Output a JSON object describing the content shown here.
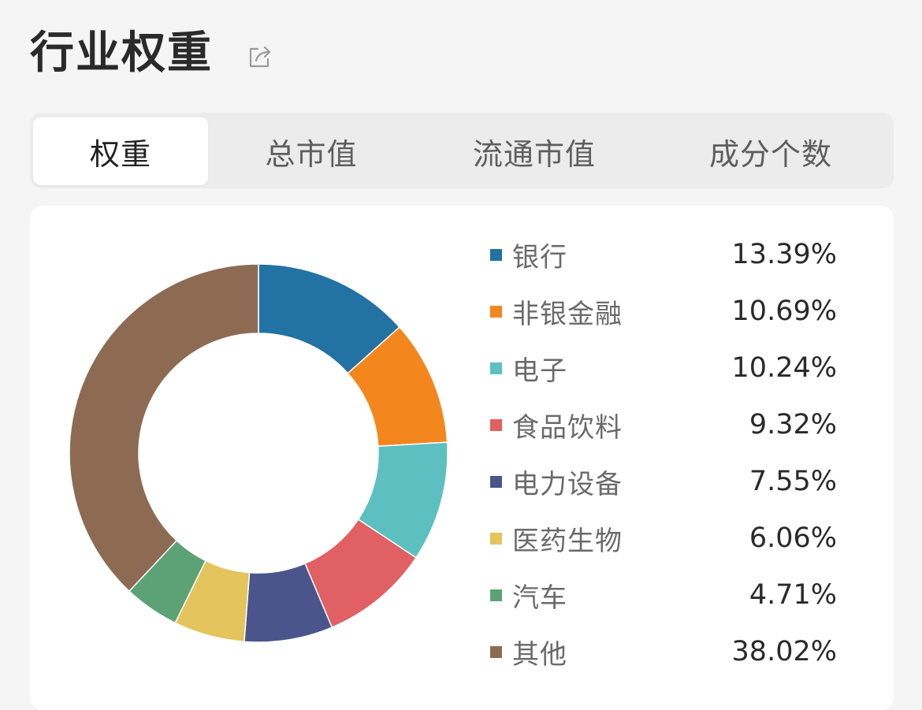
{
  "header": {
    "title": "行业权重",
    "share_icon": "share-icon"
  },
  "tabs": [
    {
      "label": "权重",
      "active": true
    },
    {
      "label": "总市值",
      "active": false
    },
    {
      "label": "流通市值",
      "active": false
    },
    {
      "label": "成分个数",
      "active": false
    }
  ],
  "chart_data": {
    "type": "pie",
    "title": "",
    "categories": [
      "银行",
      "非银金融",
      "电子",
      "食品饮料",
      "电力设备",
      "医药生物",
      "汽车",
      "其他"
    ],
    "values": [
      13.39,
      10.69,
      10.24,
      9.32,
      7.55,
      6.06,
      4.71,
      38.02
    ],
    "value_labels": [
      "13.39%",
      "10.69%",
      "10.24%",
      "9.32%",
      "7.55%",
      "6.06%",
      "4.71%",
      "38.02%"
    ],
    "colors": [
      "#2272a3",
      "#f4861e",
      "#5dbfc0",
      "#e06063",
      "#4a568b",
      "#e3c45d",
      "#5da276",
      "#8d6b53"
    ],
    "legend_position": "right",
    "donut": true
  }
}
